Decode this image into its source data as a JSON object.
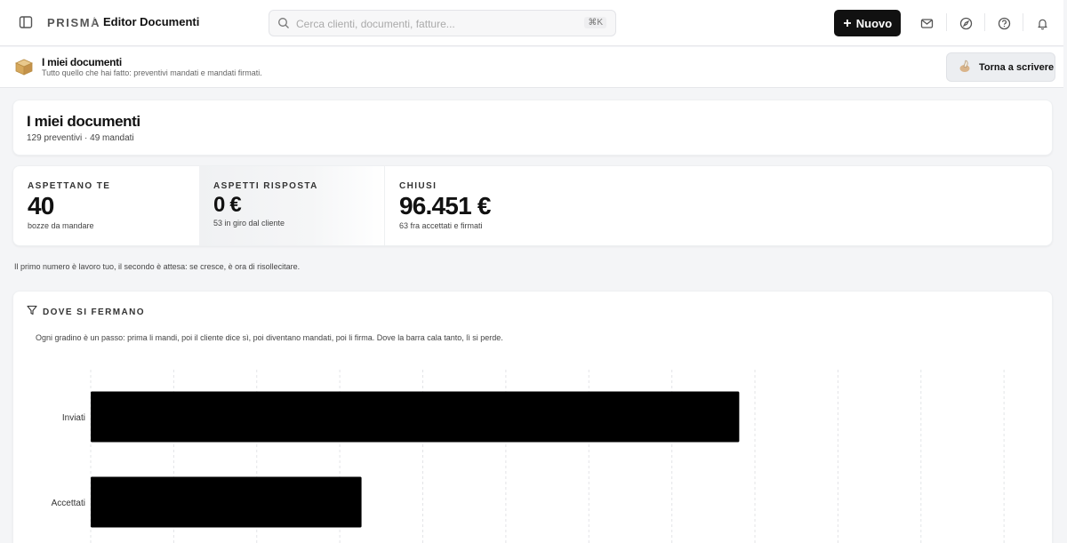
{
  "topbar": {
    "brand": "PRISMA",
    "separator": "/",
    "current": "Editor Documenti",
    "search_placeholder": "Cerca clienti, documenti, fatture...",
    "search_shortcut": "⌘K",
    "new_button": "Nuovo",
    "icons": [
      "sidebar-toggle-icon",
      "mail-icon",
      "compass-icon",
      "help-icon",
      "bell-icon"
    ]
  },
  "subheader": {
    "title": "I miei documenti",
    "description": "Tutto quello che hai fatto: preventivi mandati e mandati firmati.",
    "back_button": "Torna a scrivere"
  },
  "page": {
    "title": "I miei documenti",
    "subtitle": "129 preventivi · 49 mandati"
  },
  "stats": [
    {
      "label": "ASPETTANO TE",
      "value": "40",
      "note": "bozze da mandare"
    },
    {
      "label": "ASPETTI RISPOSTA",
      "value": "0 €",
      "note": "53 in giro dal cliente"
    },
    {
      "label": "CHIUSI",
      "value": "96.451 €",
      "note": "63 fra accettati e firmati"
    }
  ],
  "hint": "Il primo numero è lavoro tuo, il secondo è attesa: se cresce, è ora di risollecitare.",
  "funnel": {
    "heading": "DOVE SI FERMANO",
    "description": "Ogni gradino è un passo: prima li mandi, poi il cliente dice sì, poi diventano mandati, poi li firma. Dove la barra cala tanto, lì si perde."
  },
  "chart_data": {
    "type": "bar",
    "orientation": "horizontal",
    "categories": [
      "Inviati",
      "Accettati"
    ],
    "values": [
      91,
      38
    ],
    "xlim": [
      0,
      131
    ],
    "grid": true,
    "bar_color": "#000000"
  },
  "colors": {
    "accent": "#111111",
    "background": "#f4f5f7",
    "card": "#ffffff"
  }
}
